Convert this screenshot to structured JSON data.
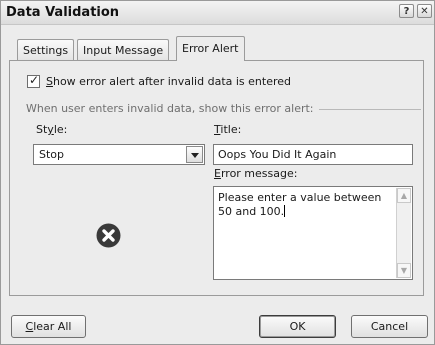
{
  "window": {
    "title": "Data Validation",
    "help_glyph": "?",
    "close_glyph": "✕",
    "icons": [
      "help-icon",
      "close-icon"
    ]
  },
  "tabs": [
    {
      "label": "Settings",
      "active": false
    },
    {
      "label": "Input Message",
      "active": false
    },
    {
      "label": "Error Alert",
      "active": true
    }
  ],
  "show_alert": {
    "checked": true,
    "label_prefix": "",
    "label_underline": "S",
    "label_rest": "how error alert after invalid data is entered"
  },
  "group_label": "When user enters invalid data, show this error alert:",
  "style": {
    "label_prefix": "St",
    "label_underline": "y",
    "label_rest": "le:",
    "value": "Stop",
    "icon": "error-stop-icon"
  },
  "title_field": {
    "label_underline": "T",
    "label_rest": "itle:",
    "value": "Oops You Did It Again"
  },
  "error_message": {
    "label_underline": "E",
    "label_rest": "rror message:",
    "value": "Please enter a value between 50 and 100."
  },
  "buttons": {
    "clear_all_underline": "C",
    "clear_all_rest": "lear All",
    "ok": "OK",
    "cancel": "Cancel"
  },
  "colors": {
    "error_icon": "#3a3a3a",
    "dialog_bg": "#ececec"
  }
}
